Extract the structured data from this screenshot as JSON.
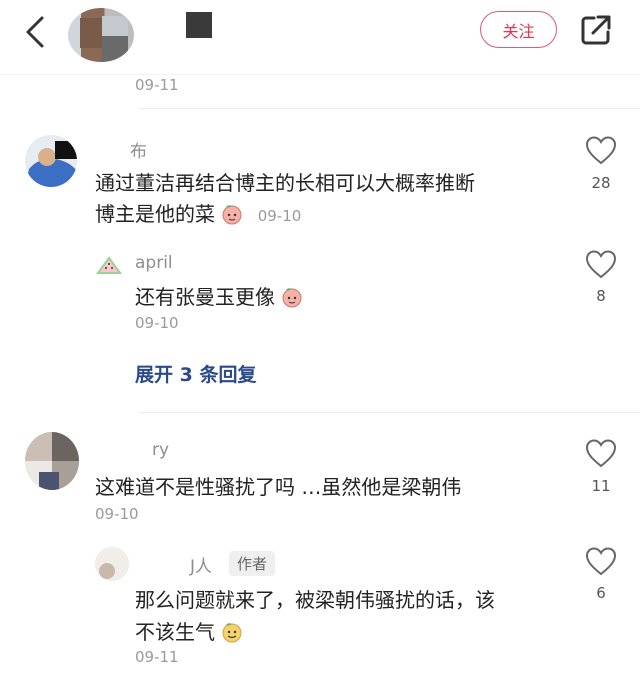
{
  "header": {
    "follow_label": "关注",
    "post_date": "09-11"
  },
  "comments": [
    {
      "username": "布",
      "text": "通过董洁再结合博主的长相可以大概率推断",
      "text2": "博主是他的菜",
      "date": "09-10",
      "likes": "28",
      "replies": [
        {
          "username": "april",
          "text": "还有张曼玉更像",
          "date": "09-10",
          "likes": "8"
        }
      ],
      "expand_label": "展开 3 条回复"
    },
    {
      "username": "ry",
      "text": "这难道不是性骚扰了吗 …虽然他是梁朝伟",
      "date": "09-10",
      "likes": "11",
      "replies": [
        {
          "username": "J人",
          "author_tag": "作者",
          "text": "那么问题就来了，被梁朝伟骚扰的话，该",
          "text2": "不该生气",
          "date": "09-11",
          "likes": "6"
        }
      ]
    }
  ],
  "colors": {
    "accent": "#e0344f",
    "link": "#2b4a8a",
    "muted": "#9a9a9a"
  },
  "icons": [
    "back-arrow-icon",
    "share-icon",
    "heart-icon",
    "peach-emoji-icon",
    "smile-emoji-icon",
    "watermelon-icon"
  ]
}
